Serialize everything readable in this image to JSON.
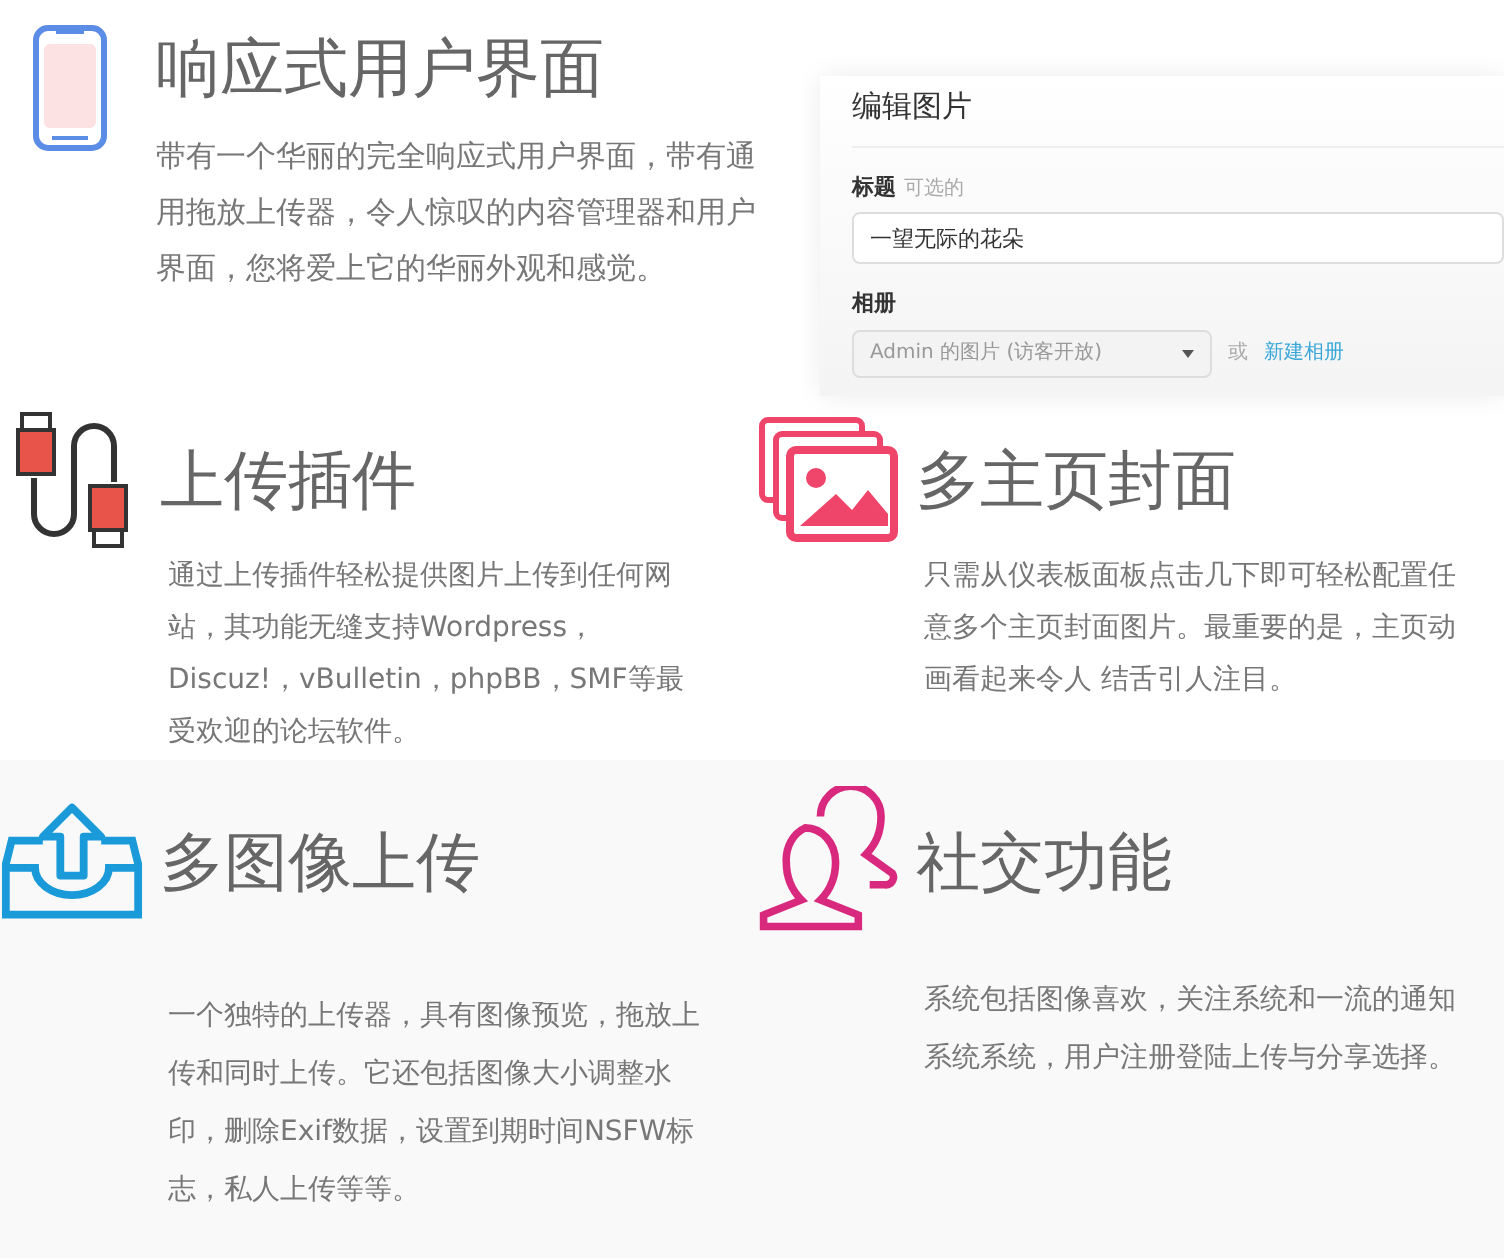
{
  "hero": {
    "kind": "phone",
    "title": "响应式用户界面",
    "text": "带有一个华丽的完全响应式用户界面，带有通用拖放上传器，令人惊叹的内容管理器和用户界面，您将爱上它的华丽外观和感觉。"
  },
  "edit_panel": {
    "heading": "编辑图片",
    "title_label": "标题",
    "title_hint": "可选的",
    "title_value": "一望无际的花朵",
    "album_label": "相册",
    "album_value": "Admin 的图片 (访客开放)",
    "or_text": "或",
    "new_album_link": "新建相册"
  },
  "features": [
    {
      "kind": "cable",
      "title": "上传插件",
      "text": "通过上传插件轻松提供图片上传到任何网站，其功能无缝支持Wordpress，Discuz!，vBulletin，phpBB，SMF等最受欢迎的论坛软件。"
    },
    {
      "kind": "gallery",
      "title": "多主页封面",
      "text": "只需从仪表板面板点击几下即可轻松配置任意多个主页封面图片。最重要的是，主页动画看起来令人 结舌引人注目。"
    },
    {
      "kind": "upload",
      "title": "多图像上传",
      "text": "一个独特的上传器，具有图像预览，拖放上传和同时上传。它还包括图像大小调整水印，删除Exif数据，设置到期时间NSFW标志，私人上传等等。"
    },
    {
      "kind": "users",
      "title": "社交功能",
      "text": "系统包括图像喜欢，关注系统和一流的通知系统系统，用户注册登陆上传与分享选择。"
    }
  ]
}
